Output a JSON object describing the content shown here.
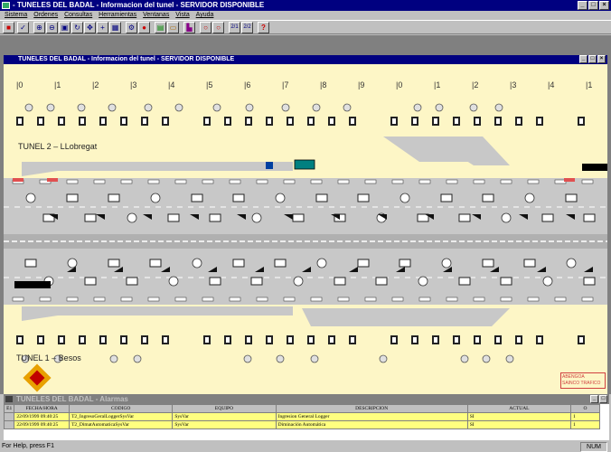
{
  "app": {
    "title": "- TUNELES DEL BADAL - Informacion del tunel - SERVIDOR DISPONIBLE",
    "menu": [
      "Sistema",
      "Ordenes",
      "Consultas",
      "Herramientas",
      "Ventanas",
      "Vista",
      "Ayuda"
    ],
    "toolbar_icons": [
      "stop-icon",
      "check-icon",
      "zoom-in-icon",
      "zoom-out-icon",
      "zoom-area-icon",
      "refresh-icon",
      "pan-icon",
      "move-icon",
      "grid-icon",
      "settings-icon",
      "camera-icon",
      "screen-icon",
      "folder-icon",
      "chart-icon",
      "signal-a-icon",
      "signal-b-icon",
      "view-212-icon",
      "view-222-icon",
      "help-icon"
    ],
    "toolbar_text": {
      "view_a": "2/1",
      "view_b": "2/2",
      "help": "?"
    }
  },
  "child_window": {
    "title": "TUNELES DEL BADAL - Informacion del tunel - SERVIDOR DISPONIBLE"
  },
  "schematic": {
    "pk_labels": [
      "0",
      "1",
      "2",
      "3",
      "4",
      "5",
      "6",
      "7",
      "8",
      "9",
      "0",
      "1",
      "2",
      "3",
      "4",
      "1"
    ],
    "tunnel2_label": "TUNEL 2 – LLobregat",
    "tunnel1_label": "TUNEL 1 – Besos",
    "brand_line1": "ABENGOA",
    "brand_line2": "SAINCO TRAFICO"
  },
  "alarms": {
    "title": "TUNELES DEL BADAL - Alarmas",
    "columns": [
      "E1",
      "FECHA/HORA",
      "CODIGO",
      "EQUIPO",
      "DESCRIPCION",
      "ACTUAL",
      "O"
    ],
    "rows": [
      [
        "",
        "22/09/1999 09:40:25",
        "T2_IngresoGeralLoggerSysVar",
        "SysVar",
        "Ingresion General Logger",
        "SI",
        "1"
      ],
      [
        "",
        "22/09/1999 09:40:25",
        "T2_DimatAutomaticaSysVar",
        "SysVar",
        "Diminación Automática",
        "SI",
        "1"
      ]
    ]
  },
  "status": {
    "help": "For Help, press F1",
    "num": "NUM"
  }
}
